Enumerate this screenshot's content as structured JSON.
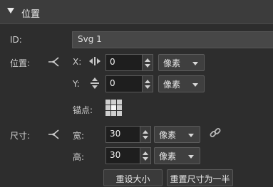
{
  "section": {
    "title": "位置"
  },
  "id_row": {
    "label": "ID:",
    "value": "Svg 1"
  },
  "position": {
    "label": "位置:",
    "x": {
      "label": "X:",
      "value": "0",
      "unit": "像素"
    },
    "y": {
      "label": "Y:",
      "value": "0",
      "unit": "像素"
    },
    "anchor_label": "锚点:"
  },
  "size": {
    "label": "尺寸:",
    "width": {
      "label": "宽:",
      "value": "30",
      "unit": "像素"
    },
    "height": {
      "label": "高:",
      "value": "30",
      "unit": "像素"
    },
    "reset_button": "重设大小",
    "half_button": "重置尺寸为一半"
  }
}
